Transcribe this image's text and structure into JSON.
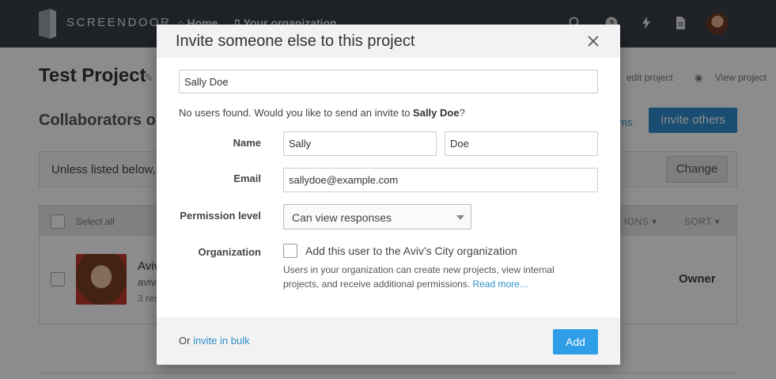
{
  "topbar": {
    "brand": "SCREENDOOR",
    "nav": [
      {
        "label": "Home",
        "icon": "home-icon"
      },
      {
        "label": "Your organization",
        "icon": "building-icon"
      }
    ],
    "icons": [
      "search-icon",
      "help-icon",
      "bolt-icon",
      "document-icon",
      "user-avatar"
    ]
  },
  "page": {
    "title": "Test Project",
    "links": [
      "edit project",
      "View project"
    ],
    "section_title": "Collaborators on",
    "permissions_link": "ms",
    "invite_others_label": "Invite others",
    "notice_text": "Unless listed below,",
    "change_label": "Change",
    "table": {
      "select_all": "Select all",
      "col_permissions": "IONS",
      "col_sort": "SORT",
      "rows": [
        {
          "name": "Aviv",
          "email": "avive",
          "responses": "3 res",
          "role": "Owner"
        }
      ]
    }
  },
  "modal": {
    "title": "Invite someone else to this project",
    "search_value": "Sally Doe",
    "no_users_prefix": "No users found. Would you like to send an invite to ",
    "no_users_name": "Sally Doe",
    "no_users_suffix": "?",
    "name_label": "Name",
    "first_name": "Sally",
    "last_name": "Doe",
    "email_label": "Email",
    "email_value": "sallydoe@example.com",
    "permission_label": "Permission level",
    "permission_value": "Can view responses",
    "organization_label": "Organization",
    "org_checkbox_label": "Add this user to the Aviv's City organization",
    "org_help": "Users in your organization can create new projects, view internal projects, and receive additional permissions.",
    "read_more": "Read more…",
    "footer_prefix": "Or ",
    "footer_link": "invite in bulk",
    "add_label": "Add"
  },
  "colors": {
    "topbar": "#3a4049",
    "primary": "#2f9ee6",
    "link": "#2d8ec8"
  }
}
